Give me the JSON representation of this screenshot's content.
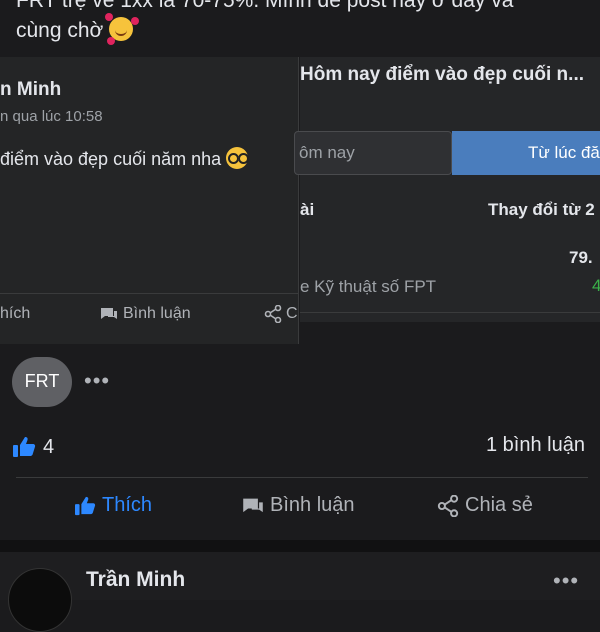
{
  "caption": {
    "line1": "FRT trệ về 1xx là 70-75%. Mình để post này ở đây và",
    "line2": "cùng chờ",
    "emoji": "smiling-face-with-hearts"
  },
  "left_screenshot": {
    "author": "n Minh",
    "time": "n qua lúc 10:58",
    "text": "điểm vào đẹp cuối năm nha",
    "emoji": "nerd-face",
    "actions": [
      "hích",
      "Bình luận",
      "C"
    ]
  },
  "right_screenshot": {
    "title": "Hôm nay điểm vào đẹp cuối n...",
    "search_placeholder": "ôm nay",
    "active_tab": "Từ lúc đă",
    "col1_header": "ài",
    "col2_header": "Thay đổi từ 2",
    "row_value": "79.",
    "row_name": "e Kỹ thuật số FPT",
    "row_change": "4"
  },
  "post": {
    "avatar_text": "FRT",
    "more": "•••",
    "like_count": "4",
    "comments": "1 bình luận",
    "like_label": "Thích",
    "comment_label": "Bình luận",
    "share_label": "Chia sẻ"
  },
  "next_post": {
    "author": "Trần Minh",
    "more": "•••"
  },
  "colors": {
    "background": "#1b1b1d",
    "accent": "#2d88ff",
    "tab_active": "#4a7dbd",
    "positive": "#3bb34a"
  }
}
